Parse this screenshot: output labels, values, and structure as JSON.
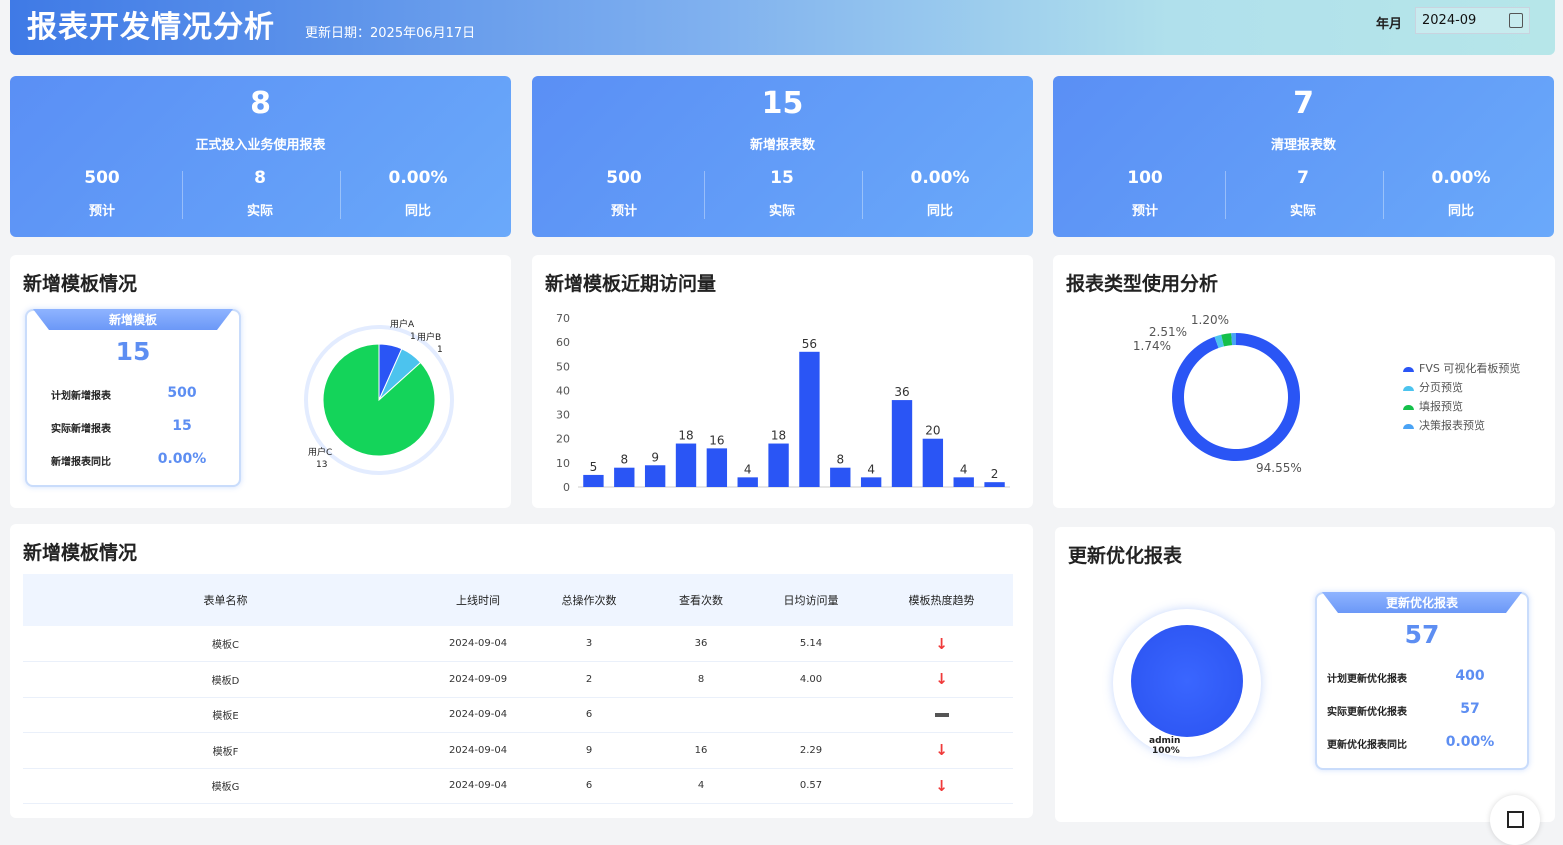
{
  "header": {
    "title": "报表开发情况分析",
    "update_date": "更新日期：2025年06月17日",
    "month_label": "年月",
    "month_value": "2024-09"
  },
  "kpis": [
    {
      "value": "8",
      "label": "正式投入业务使用报表",
      "planned": "500",
      "actual": "8",
      "yoy": "0.00%",
      "planned_label": "预计",
      "actual_label": "实际",
      "yoy_label": "同比"
    },
    {
      "value": "15",
      "label": "新增报表数",
      "planned": "500",
      "actual": "15",
      "yoy": "0.00%",
      "planned_label": "预计",
      "actual_label": "实际",
      "yoy_label": "同比"
    },
    {
      "value": "7",
      "label": "清理报表数",
      "planned": "100",
      "actual": "7",
      "yoy": "0.00%",
      "planned_label": "预计",
      "actual_label": "实际",
      "yoy_label": "同比"
    }
  ],
  "template_panel": {
    "title": "新增模板情况",
    "box_title": "新增模板",
    "box_value": "15",
    "rows": [
      {
        "label": "计划新增报表",
        "value": "500"
      },
      {
        "label": "实际新增报表",
        "value": "15"
      },
      {
        "label": "新增报表同比",
        "value": "0.00%"
      }
    ]
  },
  "visits_panel": {
    "title": "新增模板近期访问量"
  },
  "type_panel": {
    "title": "报表类型使用分析"
  },
  "table_panel": {
    "title": "新增模板情况",
    "columns": [
      "表单名称",
      "上线时间",
      "总操作次数",
      "查看次数",
      "日均访问量",
      "模板热度趋势"
    ],
    "rows": [
      {
        "name": "模板C",
        "date": "2024-09-04",
        "ops": "3",
        "views": "36",
        "daily": "5.14",
        "trend": "down"
      },
      {
        "name": "模板D",
        "date": "2024-09-09",
        "ops": "2",
        "views": "8",
        "daily": "4.00",
        "trend": "down"
      },
      {
        "name": "模板E",
        "date": "2024-09-04",
        "ops": "6",
        "views": "",
        "daily": "",
        "trend": "flat"
      },
      {
        "name": "模板F",
        "date": "2024-09-04",
        "ops": "9",
        "views": "16",
        "daily": "2.29",
        "trend": "down"
      },
      {
        "name": "模板G",
        "date": "2024-09-04",
        "ops": "6",
        "views": "4",
        "daily": "0.57",
        "trend": "down"
      }
    ]
  },
  "optimize_panel": {
    "title": "更新优化报表",
    "box_title": "更新优化报表",
    "box_value": "57",
    "rows": [
      {
        "label": "计划更新优化报表",
        "value": "400"
      },
      {
        "label": "实际更新优化报表",
        "value": "57"
      },
      {
        "label": "更新优化报表同比",
        "value": "0.00%"
      }
    ],
    "pie_label": "admin",
    "pie_pct": "100%"
  },
  "chart_data": [
    {
      "type": "pie",
      "title": "新增模板情况",
      "slices": [
        {
          "name": "用户A",
          "value": 1,
          "color": "#2a55f5"
        },
        {
          "name": "用户B",
          "value": 1,
          "color": "#4cc3ee"
        },
        {
          "name": "用户C",
          "value": 13,
          "color": "#14d45a"
        }
      ]
    },
    {
      "type": "bar",
      "title": "新增模板近期访问量",
      "values": [
        5,
        8,
        9,
        18,
        16,
        4,
        18,
        56,
        8,
        4,
        36,
        20,
        4,
        2
      ],
      "ylim": [
        0,
        70
      ],
      "yticks": [
        0,
        10,
        20,
        30,
        40,
        50,
        60,
        70
      ],
      "color": "#2a55f5"
    },
    {
      "type": "pie",
      "title": "报表类型使用分析",
      "donut": true,
      "slices": [
        {
          "name": "FVS 可视化看板预览",
          "value": 94.55,
          "label": "94.55%",
          "color": "#2a55f5"
        },
        {
          "name": "分页预览",
          "value": 1.74,
          "label": "1.74%",
          "color": "#4cc3ee"
        },
        {
          "name": "填报预览",
          "value": 2.51,
          "label": "2.51%",
          "color": "#14c04a"
        },
        {
          "name": "决策报表预览",
          "value": 1.2,
          "label": "1.20%",
          "color": "#4aa3f5"
        }
      ]
    },
    {
      "type": "pie",
      "title": "更新优化报表",
      "slices": [
        {
          "name": "admin",
          "value": 100,
          "label": "100%",
          "color": "#2a55f5"
        }
      ]
    }
  ]
}
